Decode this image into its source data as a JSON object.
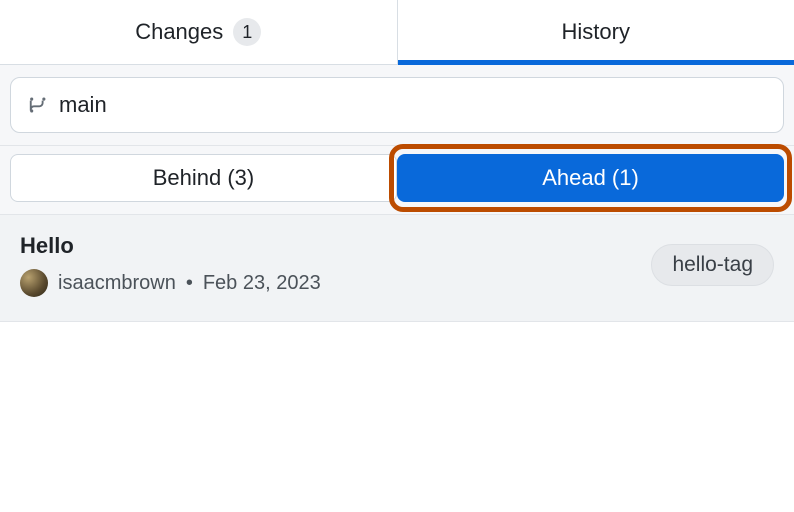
{
  "tabs": {
    "changes": {
      "label": "Changes",
      "badge": "1"
    },
    "history": {
      "label": "History"
    }
  },
  "branch": {
    "name": "main"
  },
  "segmented": {
    "behind": "Behind (3)",
    "ahead": "Ahead (1)"
  },
  "commit": {
    "title": "Hello",
    "author": "isaacmbrown",
    "separator": "•",
    "date": "Feb 23, 2023",
    "tag": "hello-tag"
  },
  "colors": {
    "accent": "#0969da",
    "highlight": "#bc4c00"
  }
}
